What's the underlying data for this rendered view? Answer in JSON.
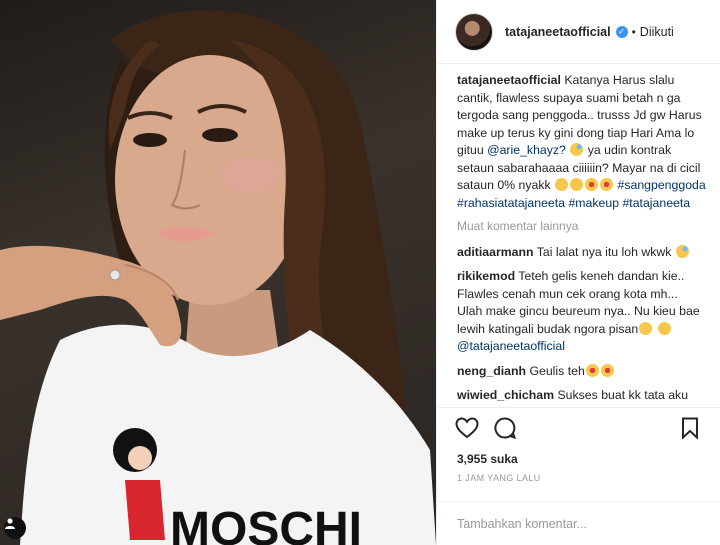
{
  "account": {
    "username": "tatajaneetaofficial",
    "follow_status": "Diikuti",
    "verified": true
  },
  "caption": {
    "username": "tatajaneetaofficial",
    "text": "Katanya Harus slalu cantik, flawless supaya suami betah n ga tergoda sang penggoda.. trusss Jd gw Harus make up terus ky gini dong tiap Hari Ama lo gituu ",
    "mention": "@arie_khayz?",
    "text2": " ya udin kontrak setaun sabarahaaaa ciiiiiin? Mayar na di cicil sataun 0% nyakk ",
    "hashtags": "#sangpenggoda #rahasiatatajaneeta #makeup #tatajaneeta"
  },
  "more_comments_label": "Muat komentar lainnya",
  "comments": [
    {
      "username": "aditiaarmann",
      "text": "Tai lalat nya itu loh wkwk"
    },
    {
      "username": "rikikemod",
      "text": "Teteh gelis keneh dandan kie.. Flawles cenah mun cek orang kota mh... Ulah make gincu beureum nya.. Nu kieu bae lewih katingali budak ngora pisan",
      "mention": "@tatajaneetaofficial"
    },
    {
      "username": "neng_dianh",
      "text": "Geulis teh"
    },
    {
      "username": "wiwied_chicham",
      "text": "Sukses buat kk tata aku"
    }
  ],
  "likes": "3,955 suka",
  "timestamp": "1 JAM YANG LALU",
  "add_comment_placeholder": "Tambahkan komentar...",
  "colors": {
    "link": "#003569",
    "verified": "#3897f0",
    "muted": "#999999"
  },
  "icons": {
    "like": "heart-outline-icon",
    "comment": "speech-bubble-icon",
    "save": "bookmark-icon",
    "tag": "person-tag-icon"
  }
}
